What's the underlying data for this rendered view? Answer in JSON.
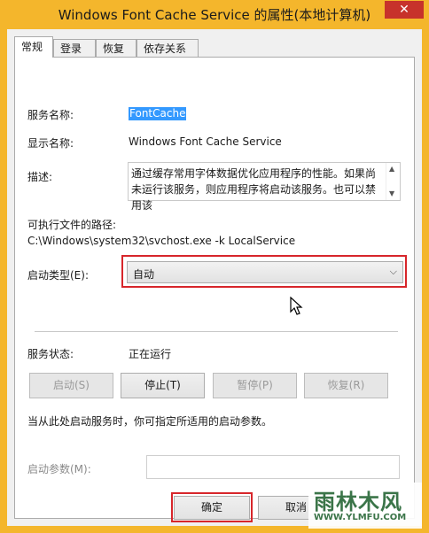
{
  "window": {
    "title": "Windows Font Cache Service 的属性(本地计算机)",
    "close_glyph": "✕"
  },
  "tabs": [
    "常规",
    "登录",
    "恢复",
    "依存关系"
  ],
  "general": {
    "service_name_label": "服务名称:",
    "service_name_value": "FontCache",
    "display_name_label": "显示名称:",
    "display_name_value": "Windows Font Cache Service",
    "description_label": "描述:",
    "description_value": "通过缓存常用字体数据优化应用程序的性能。如果尚未运行该服务，则应用程序将启动该服务。也可以禁用该",
    "exe_path_label": "可执行文件的路径:",
    "exe_path_value": "C:\\Windows\\system32\\svchost.exe -k LocalService",
    "startup_type_label": "启动类型(E):",
    "startup_type_value": "自动",
    "status_label": "服务状态:",
    "status_value": "正在运行",
    "buttons": {
      "start": "启动(S)",
      "stop": "停止(T)",
      "pause": "暂停(P)",
      "resume": "恢复(R)"
    },
    "hint": "当从此处启动服务时，你可指定所适用的启动参数。",
    "start_params_label": "启动参数(M):",
    "start_params_value": ""
  },
  "footer": {
    "ok": "确定",
    "cancel": "取消"
  },
  "watermark": {
    "main": "雨林木风",
    "sub": "WWW.YLMFU.COM"
  },
  "colors": {
    "frame": "#f4b62c",
    "highlight": "#d7262b",
    "selection": "#3399ff"
  }
}
